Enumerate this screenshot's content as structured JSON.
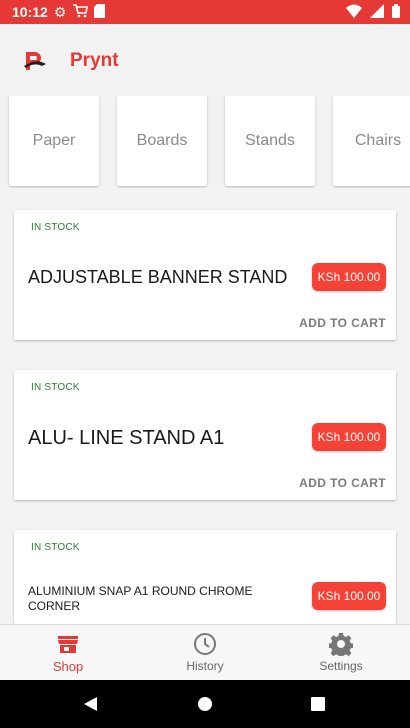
{
  "status_bar": {
    "time": "10:12"
  },
  "app": {
    "title": "Prynt"
  },
  "categories": [
    "Paper",
    "Boards",
    "Stands",
    "Chairs"
  ],
  "products": [
    {
      "stock": "IN STOCK",
      "name": "ADJUSTABLE BANNER STAND",
      "price": "KSh 100.00",
      "action": "ADD TO CART"
    },
    {
      "stock": "IN STOCK",
      "name": "ALU- LINE STAND A1",
      "price": "KSh 100.00",
      "action": "ADD TO CART"
    },
    {
      "stock": "IN STOCK",
      "name": "ALUMINIUM SNAP A1  ROUND CHROME CORNER",
      "price": "KSh 100.00"
    }
  ],
  "nav": {
    "shop": "Shop",
    "history": "History",
    "settings": "Settings"
  },
  "colors": {
    "accent": "#e53935",
    "in_stock": "#2e7d32"
  }
}
